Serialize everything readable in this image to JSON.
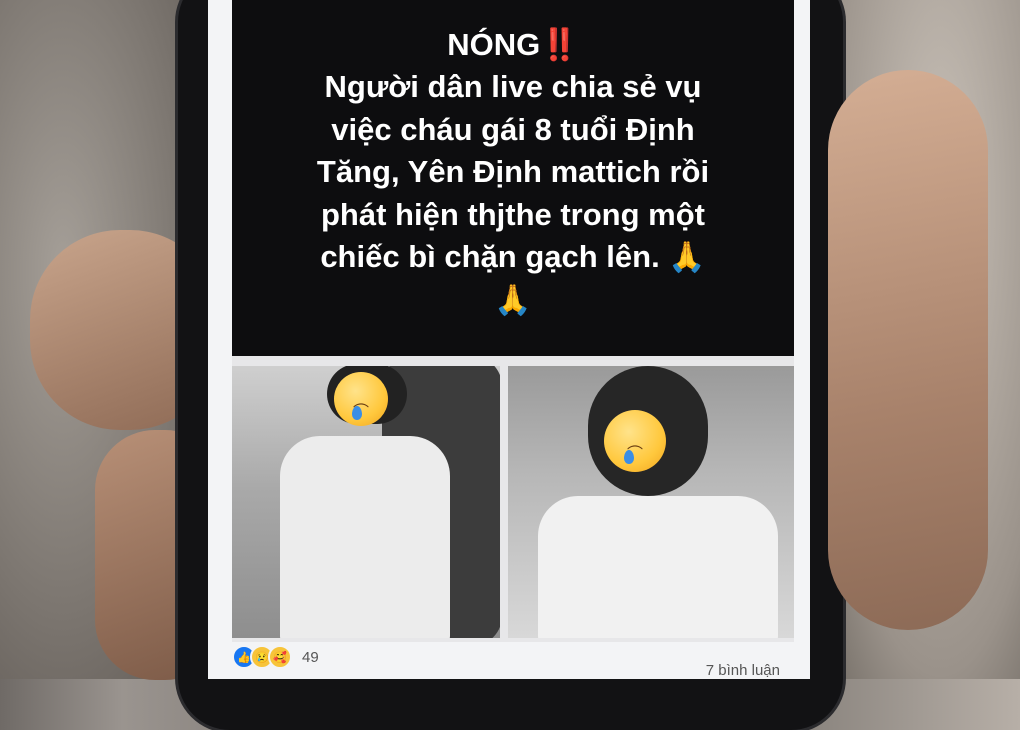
{
  "post": {
    "headline_hot": "NÓNG",
    "headline_hot_mark": "‼️",
    "headline_lines": [
      "Người dân live chia sẻ vụ",
      "việc cháu gái 8 tuổi Định",
      "Tăng, Yên Định mattich rồi",
      "phát hiện thjthe trong một",
      "chiếc bì chặn gạch lên."
    ],
    "pray_emoji": "🙏",
    "images": [
      {
        "description_icon": "crying-face-emoji"
      },
      {
        "description_icon": "crying-face-emoji"
      }
    ],
    "reactions": {
      "icons": [
        "like-icon",
        "sad-icon",
        "care-icon"
      ],
      "count": "49"
    },
    "comments": "7 bình luận"
  },
  "colors": {
    "post_background": "#0d0d0f",
    "headline_text": "#ffffff",
    "hot_mark": "#e0262a",
    "like_blue": "#1877f2"
  }
}
